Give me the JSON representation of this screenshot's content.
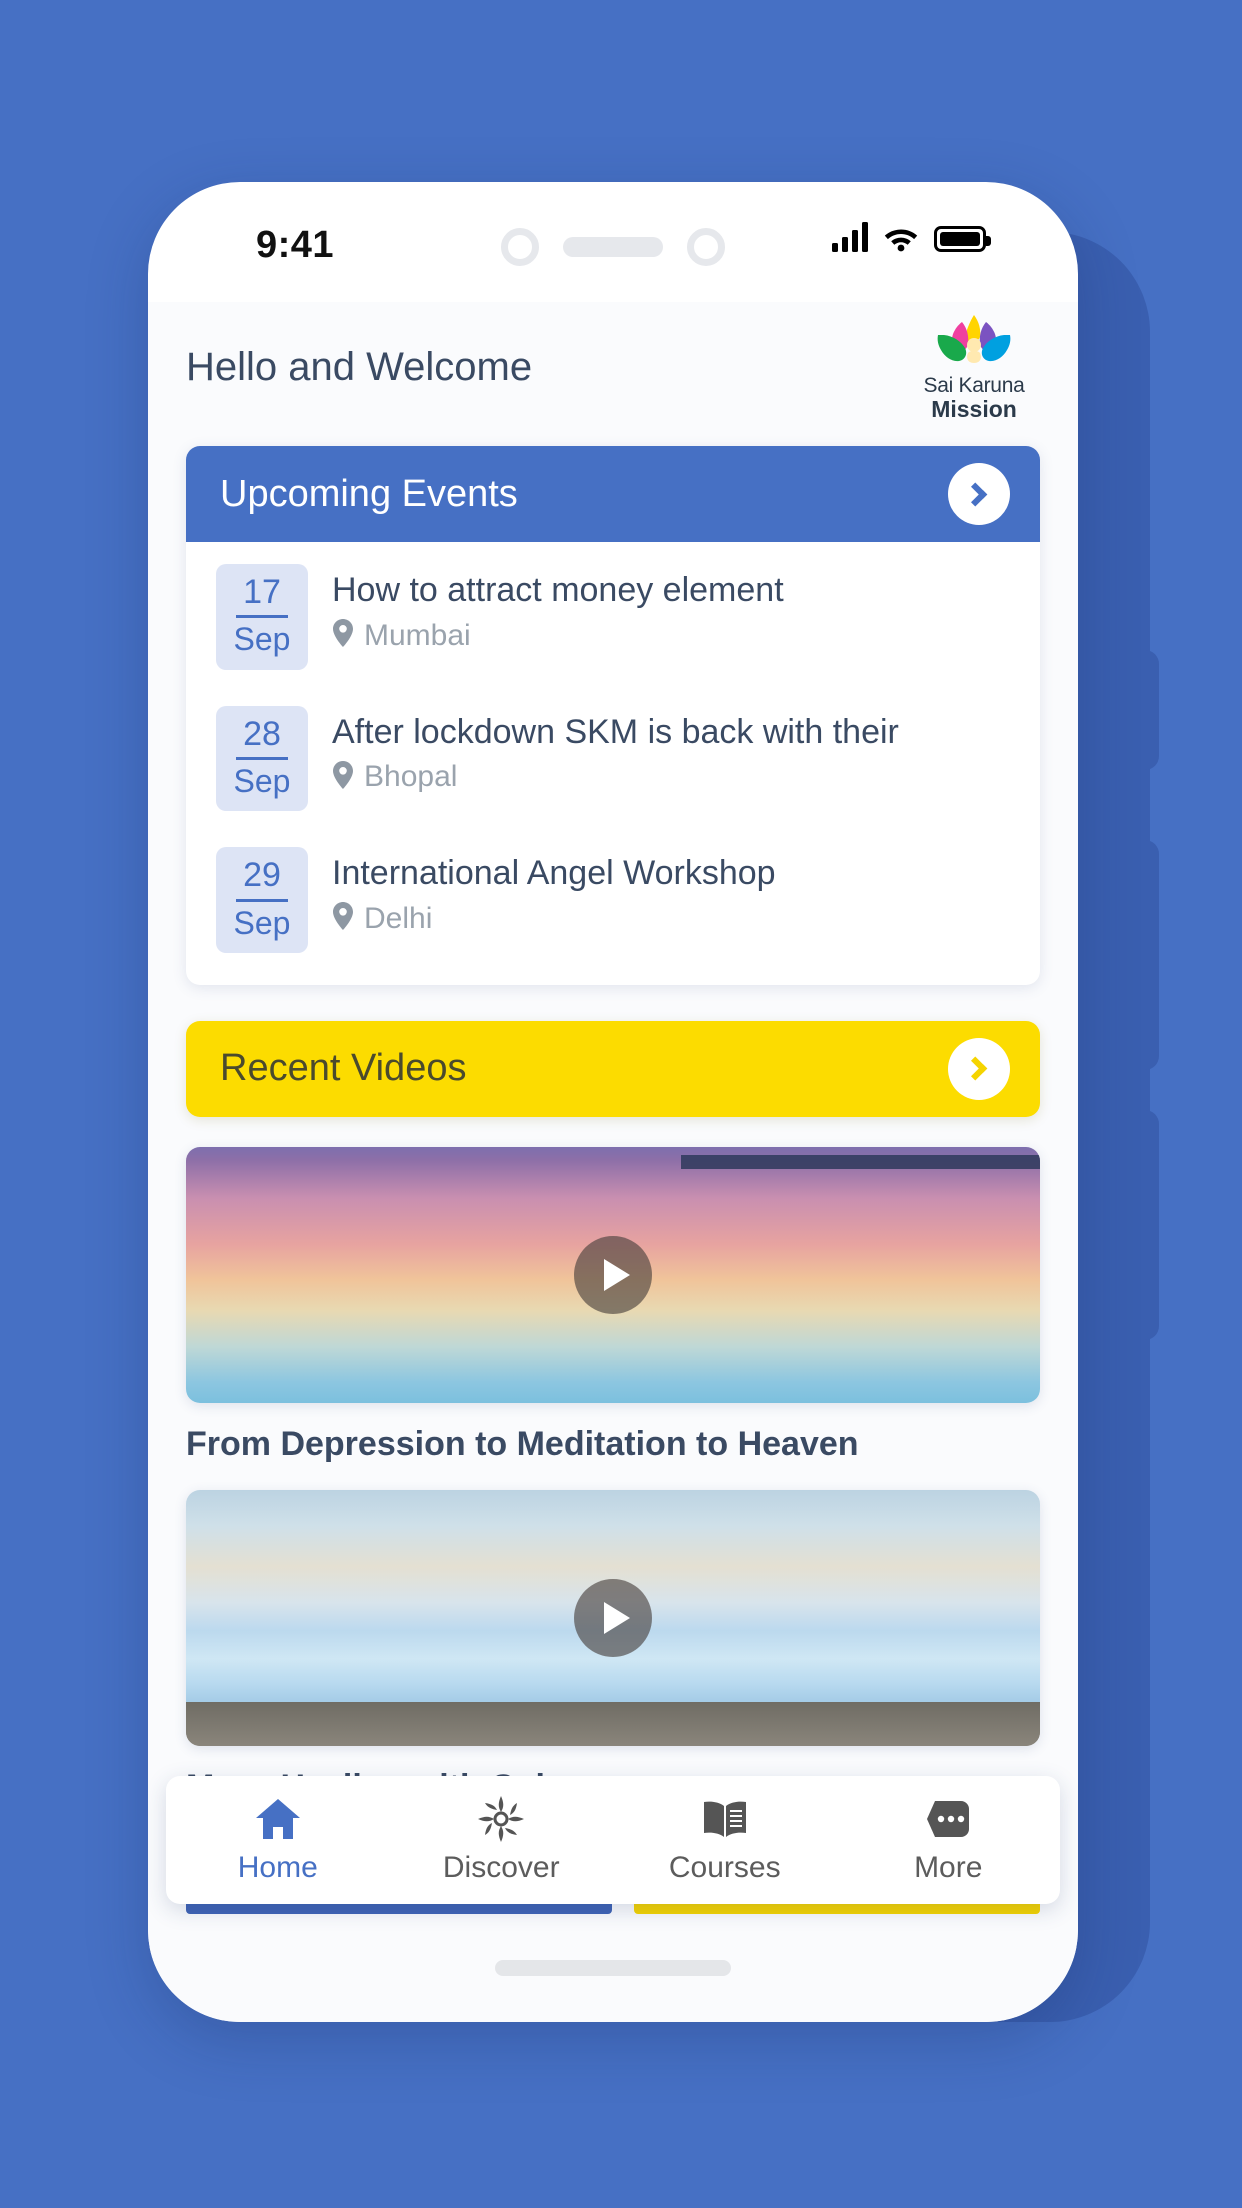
{
  "status_bar": {
    "time": "9:41",
    "signal_icon": "signal-bars-icon",
    "wifi_icon": "wifi-icon",
    "battery_icon": "battery-full-icon"
  },
  "header": {
    "greeting": "Hello and Welcome",
    "logo": {
      "line1": "Sai Karuna",
      "line2": "Mission",
      "icon": "lotus-person-logo"
    }
  },
  "events_section": {
    "title": "Upcoming Events",
    "arrow_icon": "chevron-right-icon",
    "header_color": "#4670c4",
    "items": [
      {
        "day": "17",
        "month": "Sep",
        "title": "How to attract money element",
        "location": "Mumbai",
        "pin_icon": "map-pin-icon"
      },
      {
        "day": "28",
        "month": "Sep",
        "title": "After lockdown SKM is back with their",
        "location": "Bhopal",
        "pin_icon": "map-pin-icon"
      },
      {
        "day": "29",
        "month": "Sep",
        "title": "International Angel Workshop",
        "location": "Delhi",
        "pin_icon": "map-pin-icon"
      }
    ]
  },
  "videos_section": {
    "title": "Recent Videos",
    "arrow_icon": "chevron-right-icon",
    "header_color": "#fcdc00",
    "items": [
      {
        "title": "From Depression to Meditation to Heaven",
        "play_icon": "play-icon",
        "thumbnail": "sunset-sea-gradient"
      },
      {
        "title": "Mass Healing with Colours",
        "play_icon": "play-icon",
        "thumbnail": "beach-sea-foam"
      }
    ]
  },
  "bottom_nav": {
    "items": [
      {
        "label": "Home",
        "icon": "home-icon",
        "active": true
      },
      {
        "label": "Discover",
        "icon": "flower-star-icon",
        "active": false
      },
      {
        "label": "Courses",
        "icon": "open-book-icon",
        "active": false
      },
      {
        "label": "More",
        "icon": "more-dots-icon",
        "active": false
      }
    ],
    "active_color": "#4670c4",
    "inactive_color": "#5c5c5c"
  },
  "colors": {
    "page_background": "#4670c4",
    "accent_blue": "#4670c4",
    "accent_yellow": "#fcdc00",
    "text_dark": "#3a4a63",
    "text_muted": "#9aa3ad"
  }
}
